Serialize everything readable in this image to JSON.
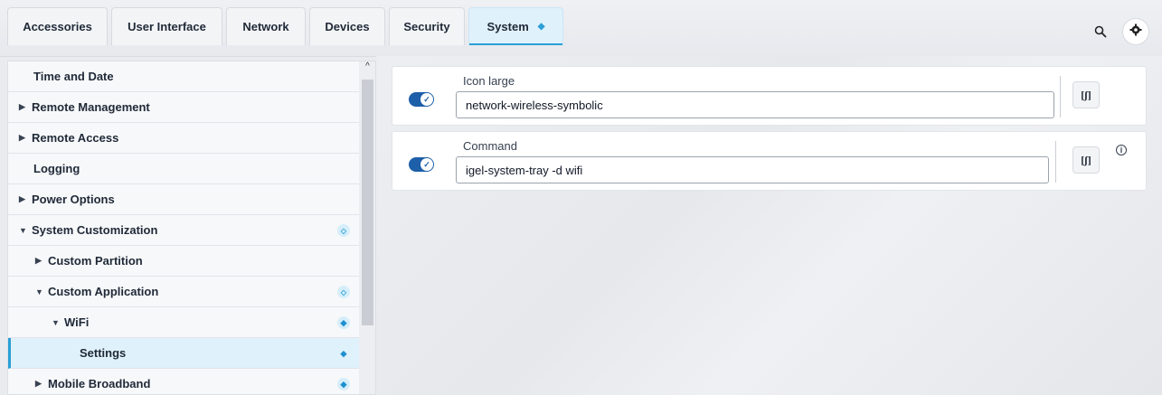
{
  "tabs": [
    {
      "label": "Accessories"
    },
    {
      "label": "User Interface"
    },
    {
      "label": "Network"
    },
    {
      "label": "Devices"
    },
    {
      "label": "Security"
    },
    {
      "label": "System",
      "active": true,
      "indicator": "◆"
    }
  ],
  "toolbar": {
    "search_icon": "search-icon",
    "settings_icon": "gear-wrench-icon"
  },
  "sidebar": {
    "items": [
      {
        "label": "Time and Date",
        "caret": ""
      },
      {
        "label": "Remote Management",
        "caret": "▶"
      },
      {
        "label": "Remote Access",
        "caret": "▶"
      },
      {
        "label": "Logging",
        "caret": ""
      },
      {
        "label": "Power Options",
        "caret": "▶"
      },
      {
        "label": "System Customization",
        "caret": "▼",
        "badge": "◇"
      },
      {
        "label": "Custom Partition",
        "caret": "▶"
      },
      {
        "label": "Custom Application",
        "caret": "▼",
        "badge": "◇"
      },
      {
        "label": "WiFi",
        "caret": "▼",
        "badge": "◆"
      },
      {
        "label": "Settings",
        "caret": "",
        "badge": "◆",
        "selected": true
      },
      {
        "label": "Mobile Broadband",
        "caret": "▶",
        "badge": "◆"
      }
    ],
    "scroll_up": "^"
  },
  "main": {
    "fields": [
      {
        "label": "Icon large",
        "value": "network-wireless-symbolic",
        "enabled": true,
        "button": "[ʃ]"
      },
      {
        "label": "Command",
        "value": "igel-system-tray -d wifi",
        "enabled": true,
        "button": "[ʃ]",
        "info": "i"
      }
    ]
  },
  "colors": {
    "accent": "#2a9fd6",
    "toggle": "#1d5fa8",
    "selected_bg": "#dff1fb"
  }
}
